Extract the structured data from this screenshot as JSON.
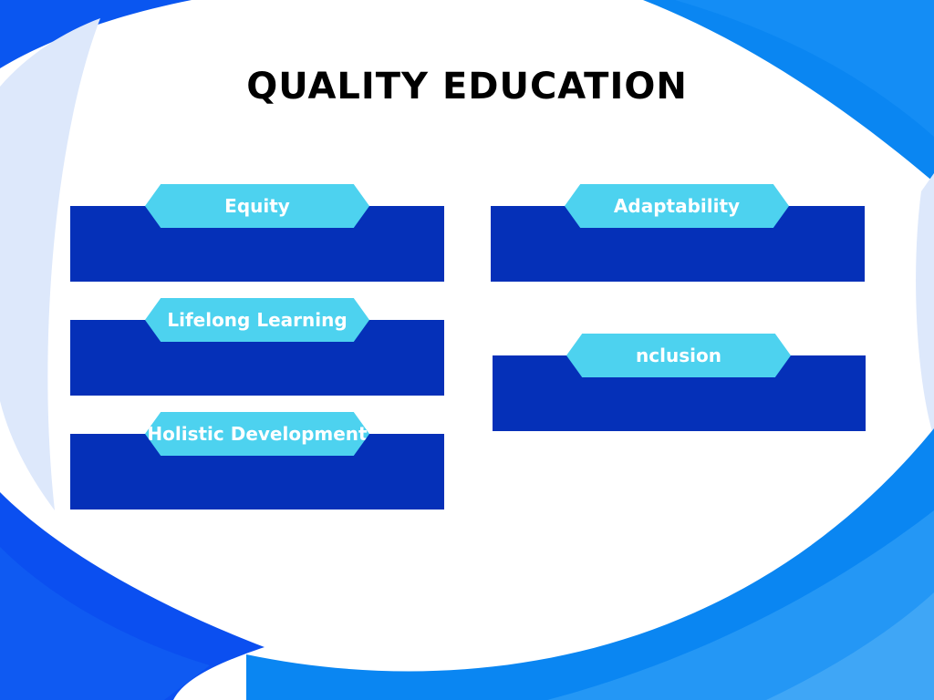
{
  "title": "QUALITY EDUCATION",
  "cards": [
    {
      "label": "Equity"
    },
    {
      "label": "Lifelong Learning"
    },
    {
      "label": "Holistic Development"
    },
    {
      "label": "Adaptability"
    },
    {
      "label": "nclusion"
    }
  ],
  "colors": {
    "card_body": "#0530b8",
    "card_label": "#4dd2ef",
    "background_blue": "#0a86f2",
    "background_deep_blue": "#0b4ff0",
    "background_pale": "#dde8fb"
  }
}
